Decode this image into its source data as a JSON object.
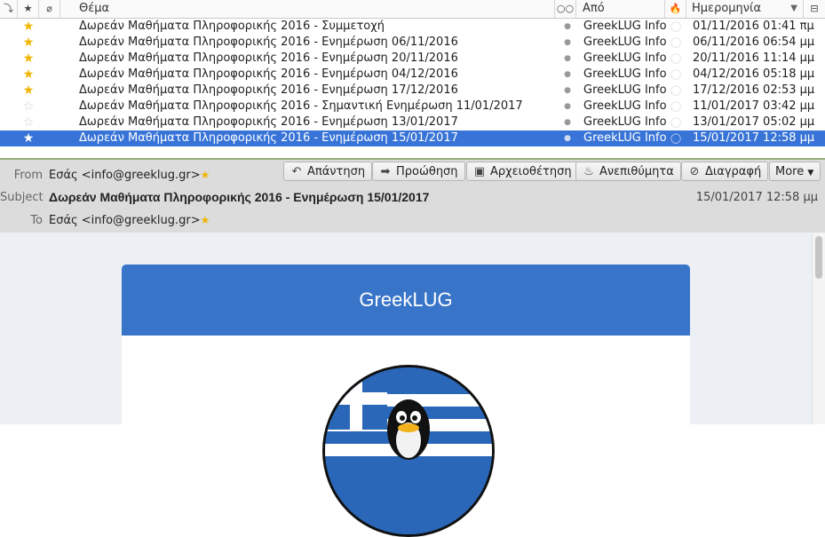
{
  "columns": {
    "thread_icon": "thread-icon",
    "star_icon": "star-icon",
    "attachment_icon": "paperclip-icon",
    "subject": "Θέμα",
    "read_icon": "read-status-icon",
    "from": "Από",
    "junk_icon": "junk-icon",
    "date": "Ημερομηνία",
    "sort_icon": "sort-descending-icon",
    "picker_icon": "column-picker-icon"
  },
  "messages": [
    {
      "starred": true,
      "subject": "Δωρεάν Μαθήματα Πληροφορικής 2016 - Συμμετοχή",
      "from": "GreekLUG Info",
      "date": "01/11/2016 01:41 πμ"
    },
    {
      "starred": true,
      "subject": "Δωρεάν Μαθήματα Πληροφορικής 2016 - Ενημέρωση 06/11/2016",
      "from": "GreekLUG Info",
      "date": "06/11/2016 06:54 μμ"
    },
    {
      "starred": true,
      "subject": "Δωρεάν Μαθήματα Πληροφορικής 2016 - Ενημέρωση 20/11/2016",
      "from": "GreekLUG Info",
      "date": "20/11/2016 11:14 μμ"
    },
    {
      "starred": true,
      "subject": "Δωρεάν Μαθήματα Πληροφορικής 2016 - Ενημέρωση 04/12/2016",
      "from": "GreekLUG Info",
      "date": "04/12/2016 05:18 μμ"
    },
    {
      "starred": true,
      "subject": "Δωρεάν Μαθήματα Πληροφορικής 2016 - Ενημέρωση 17/12/2016",
      "from": "GreekLUG Info",
      "date": "17/12/2016 02:53 μμ"
    },
    {
      "starred": false,
      "subject": "Δωρεάν Μαθήματα Πληροφορικής 2016 - Σημαντική Ενημέρωση 11/01/2017",
      "from": "GreekLUG Info",
      "date": "11/01/2017 03:42 μμ"
    },
    {
      "starred": false,
      "subject": "Δωρεάν Μαθήματα Πληροφορικής 2016 - Ενημέρωση 13/01/2017",
      "from": "GreekLUG Info",
      "date": "13/01/2017 05:02 μμ"
    },
    {
      "starred": true,
      "subject": "Δωρεάν Μαθήματα Πληροφορικής 2016 - Ενημέρωση 15/01/2017",
      "from": "GreekLUG Info",
      "date": "15/01/2017 12:58 μμ",
      "selected": true
    }
  ],
  "header": {
    "from_label": "From",
    "from_value": "Εσάς <info@greeklug.gr>",
    "subject_label": "Subject",
    "subject_value": "Δωρεάν Μαθήματα Πληροφορικής 2016 - Ενημέρωση 15/01/2017",
    "to_label": "To",
    "to_value": "Εσάς <info@greeklug.gr>",
    "date": "15/01/2017 12:58 μμ"
  },
  "buttons": {
    "reply": "Απάντηση",
    "forward": "Προώθηση",
    "archive": "Αρχειοθέτηση",
    "junk": "Ανεπιθύμητα",
    "delete": "Διαγραφή",
    "more": "More"
  },
  "email": {
    "banner_title": "GreekLUG"
  },
  "colors": {
    "selection": "#3874d7",
    "star": "#f0b400",
    "banner": "#3874c8"
  }
}
